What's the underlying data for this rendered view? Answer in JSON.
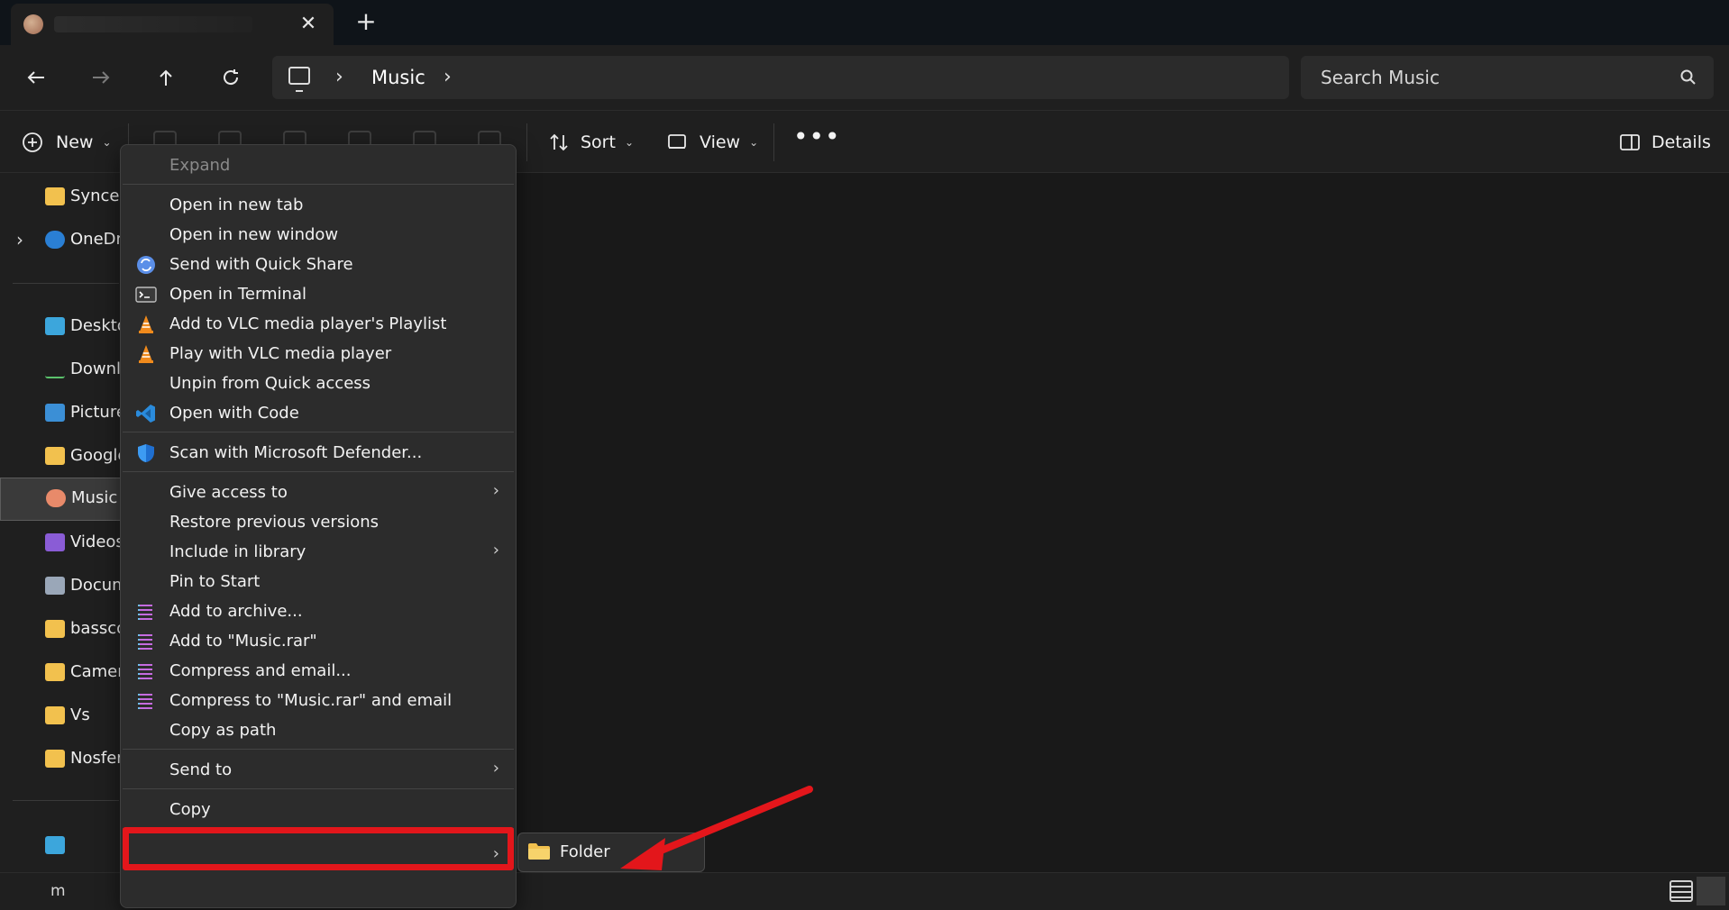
{
  "tab": {
    "close_glyph": "✕",
    "new_glyph": "+"
  },
  "address": {
    "crumb": "Music",
    "sep_glyph": "›"
  },
  "search": {
    "placeholder": "Search Music"
  },
  "toolbar": {
    "new_label": "New",
    "sort_label": "Sort",
    "view_label": "View",
    "more_glyph": "•••",
    "details_label": "Details"
  },
  "sidebar": {
    "items": [
      {
        "label": "Synced"
      },
      {
        "label": "OneDri"
      },
      {
        "label": "Deskto"
      },
      {
        "label": "Downl"
      },
      {
        "label": "Picture"
      },
      {
        "label": "Google"
      },
      {
        "label": "Music"
      },
      {
        "label": "Videos"
      },
      {
        "label": "Docum"
      },
      {
        "label": "bassco"
      },
      {
        "label": "Camera"
      },
      {
        "label": "Vs"
      },
      {
        "label": "Nosfer"
      }
    ]
  },
  "status": {
    "text": "m"
  },
  "context_menu": {
    "items": [
      {
        "label": "Expand"
      },
      {
        "label": "Open in new tab"
      },
      {
        "label": "Open in new window"
      },
      {
        "label": "Send with Quick Share"
      },
      {
        "label": "Open in Terminal"
      },
      {
        "label": "Add to VLC media player's Playlist"
      },
      {
        "label": "Play with VLC media player"
      },
      {
        "label": "Unpin from Quick access"
      },
      {
        "label": "Open with Code"
      },
      {
        "label": "Scan with Microsoft Defender..."
      },
      {
        "label": "Give access to"
      },
      {
        "label": "Restore previous versions"
      },
      {
        "label": "Include in library"
      },
      {
        "label": "Pin to Start"
      },
      {
        "label": "Add to archive..."
      },
      {
        "label": "Add to \"Music.rar\""
      },
      {
        "label": "Compress and email..."
      },
      {
        "label": "Compress to \"Music.rar\" and email"
      },
      {
        "label": "Copy as path"
      },
      {
        "label": "Send to"
      },
      {
        "label": "Copy"
      }
    ]
  },
  "submenu": {
    "folder_label": "Folder"
  },
  "colors": {
    "highlight": "#e3161b",
    "accent": "#60cdff"
  }
}
